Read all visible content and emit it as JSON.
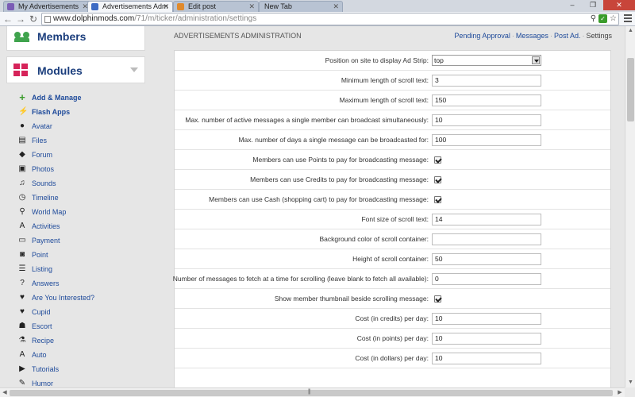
{
  "browser": {
    "tabs": [
      {
        "label": "My Advertisements",
        "active": false
      },
      {
        "label": "Advertisements Adm",
        "active": true
      },
      {
        "label": "Edit post",
        "active": false
      },
      {
        "label": "New Tab",
        "active": false
      }
    ],
    "url_host": "www.dolphinmods.com",
    "url_path": "/71/m/ticker/administration/settings"
  },
  "sidebar": {
    "members_title": "Members",
    "modules_title": "Modules",
    "items": [
      {
        "label": "Add & Manage",
        "icon": "plus-icon",
        "glyph": "+",
        "bold": true
      },
      {
        "label": "Flash Apps",
        "icon": "lightning-icon",
        "glyph": "⚡",
        "bold": true
      },
      {
        "label": "Avatar",
        "icon": "user-icon",
        "glyph": "●",
        "bold": false
      },
      {
        "label": "Files",
        "icon": "files-icon",
        "glyph": "▤",
        "bold": false
      },
      {
        "label": "Forum",
        "icon": "forum-icon",
        "glyph": "◆",
        "bold": false
      },
      {
        "label": "Photos",
        "icon": "photo-icon",
        "glyph": "▣",
        "bold": false
      },
      {
        "label": "Sounds",
        "icon": "music-icon",
        "glyph": "♫",
        "bold": false
      },
      {
        "label": "Timeline",
        "icon": "clock-icon",
        "glyph": "◷",
        "bold": false
      },
      {
        "label": "World Map",
        "icon": "map-pin-icon",
        "glyph": "⚲",
        "bold": false
      },
      {
        "label": "Activities",
        "icon": "activities-icon",
        "glyph": "A",
        "bold": false
      },
      {
        "label": "Payment",
        "icon": "credit-card-icon",
        "glyph": "▭",
        "bold": false
      },
      {
        "label": "Point",
        "icon": "point-icon",
        "glyph": "◙",
        "bold": false
      },
      {
        "label": "Listing",
        "icon": "listing-icon",
        "glyph": "☰",
        "bold": false
      },
      {
        "label": "Answers",
        "icon": "question-icon",
        "glyph": "?",
        "bold": false
      },
      {
        "label": "Are You Interested?",
        "icon": "heart-icon",
        "glyph": "♥",
        "bold": false
      },
      {
        "label": "Cupid",
        "icon": "heart-icon",
        "glyph": "♥",
        "bold": false
      },
      {
        "label": "Escort",
        "icon": "escort-icon",
        "glyph": "☗",
        "bold": false
      },
      {
        "label": "Recipe",
        "icon": "flask-icon",
        "glyph": "⚗",
        "bold": false
      },
      {
        "label": "Auto",
        "icon": "auto-icon",
        "glyph": "A",
        "bold": false
      },
      {
        "label": "Tutorials",
        "icon": "play-icon",
        "glyph": "▶",
        "bold": false
      },
      {
        "label": "Humor",
        "icon": "pencil-icon",
        "glyph": "✎",
        "bold": false
      }
    ]
  },
  "main": {
    "title": "ADVERTISEMENTS ADMINISTRATION",
    "links": {
      "pending": "Pending Approval",
      "messages": "Messages",
      "post_ad": "Post Ad.",
      "settings": "Settings"
    },
    "settings": [
      {
        "label": "Position on site to display Ad Strip:",
        "type": "select",
        "value": "top"
      },
      {
        "label": "Minimum length of scroll text:",
        "type": "text",
        "value": "3"
      },
      {
        "label": "Maximum length of scroll text:",
        "type": "text",
        "value": "150"
      },
      {
        "label": "Max. number of active messages a single member can broadcast simultaneously:",
        "type": "text",
        "value": "10"
      },
      {
        "label": "Max. number of days a single message can be broadcasted for:",
        "type": "text",
        "value": "100"
      },
      {
        "label": "Members can use Points to pay for broadcasting message:",
        "type": "checkbox",
        "value": "checked"
      },
      {
        "label": "Members can use Credits to pay for broadcasting message:",
        "type": "checkbox",
        "value": "checked"
      },
      {
        "label": "Members can use Cash (shopping cart) to pay for broadcasting message:",
        "type": "checkbox",
        "value": "checked"
      },
      {
        "label": "Font size of scroll text:",
        "type": "text",
        "value": "14"
      },
      {
        "label": "Background color of scroll container:",
        "type": "text",
        "value": ""
      },
      {
        "label": "Height of scroll container:",
        "type": "text",
        "value": "50"
      },
      {
        "label": "Number of messages to fetch at a time for scrolling (leave blank to fetch all available):",
        "type": "text",
        "value": "0"
      },
      {
        "label": "Show member thumbnail beside scrolling message:",
        "type": "checkbox",
        "value": "checked"
      },
      {
        "label": "Cost (in credits) per day:",
        "type": "text",
        "value": "10"
      },
      {
        "label": "Cost (in points) per day:",
        "type": "text",
        "value": "10"
      },
      {
        "label": "Cost (in dollars) per day:",
        "type": "text",
        "value": "10"
      }
    ]
  },
  "colors": {
    "link": "#1e4a9a",
    "members_icon": "#3fa34d",
    "modules_icon": "#d6245a"
  }
}
